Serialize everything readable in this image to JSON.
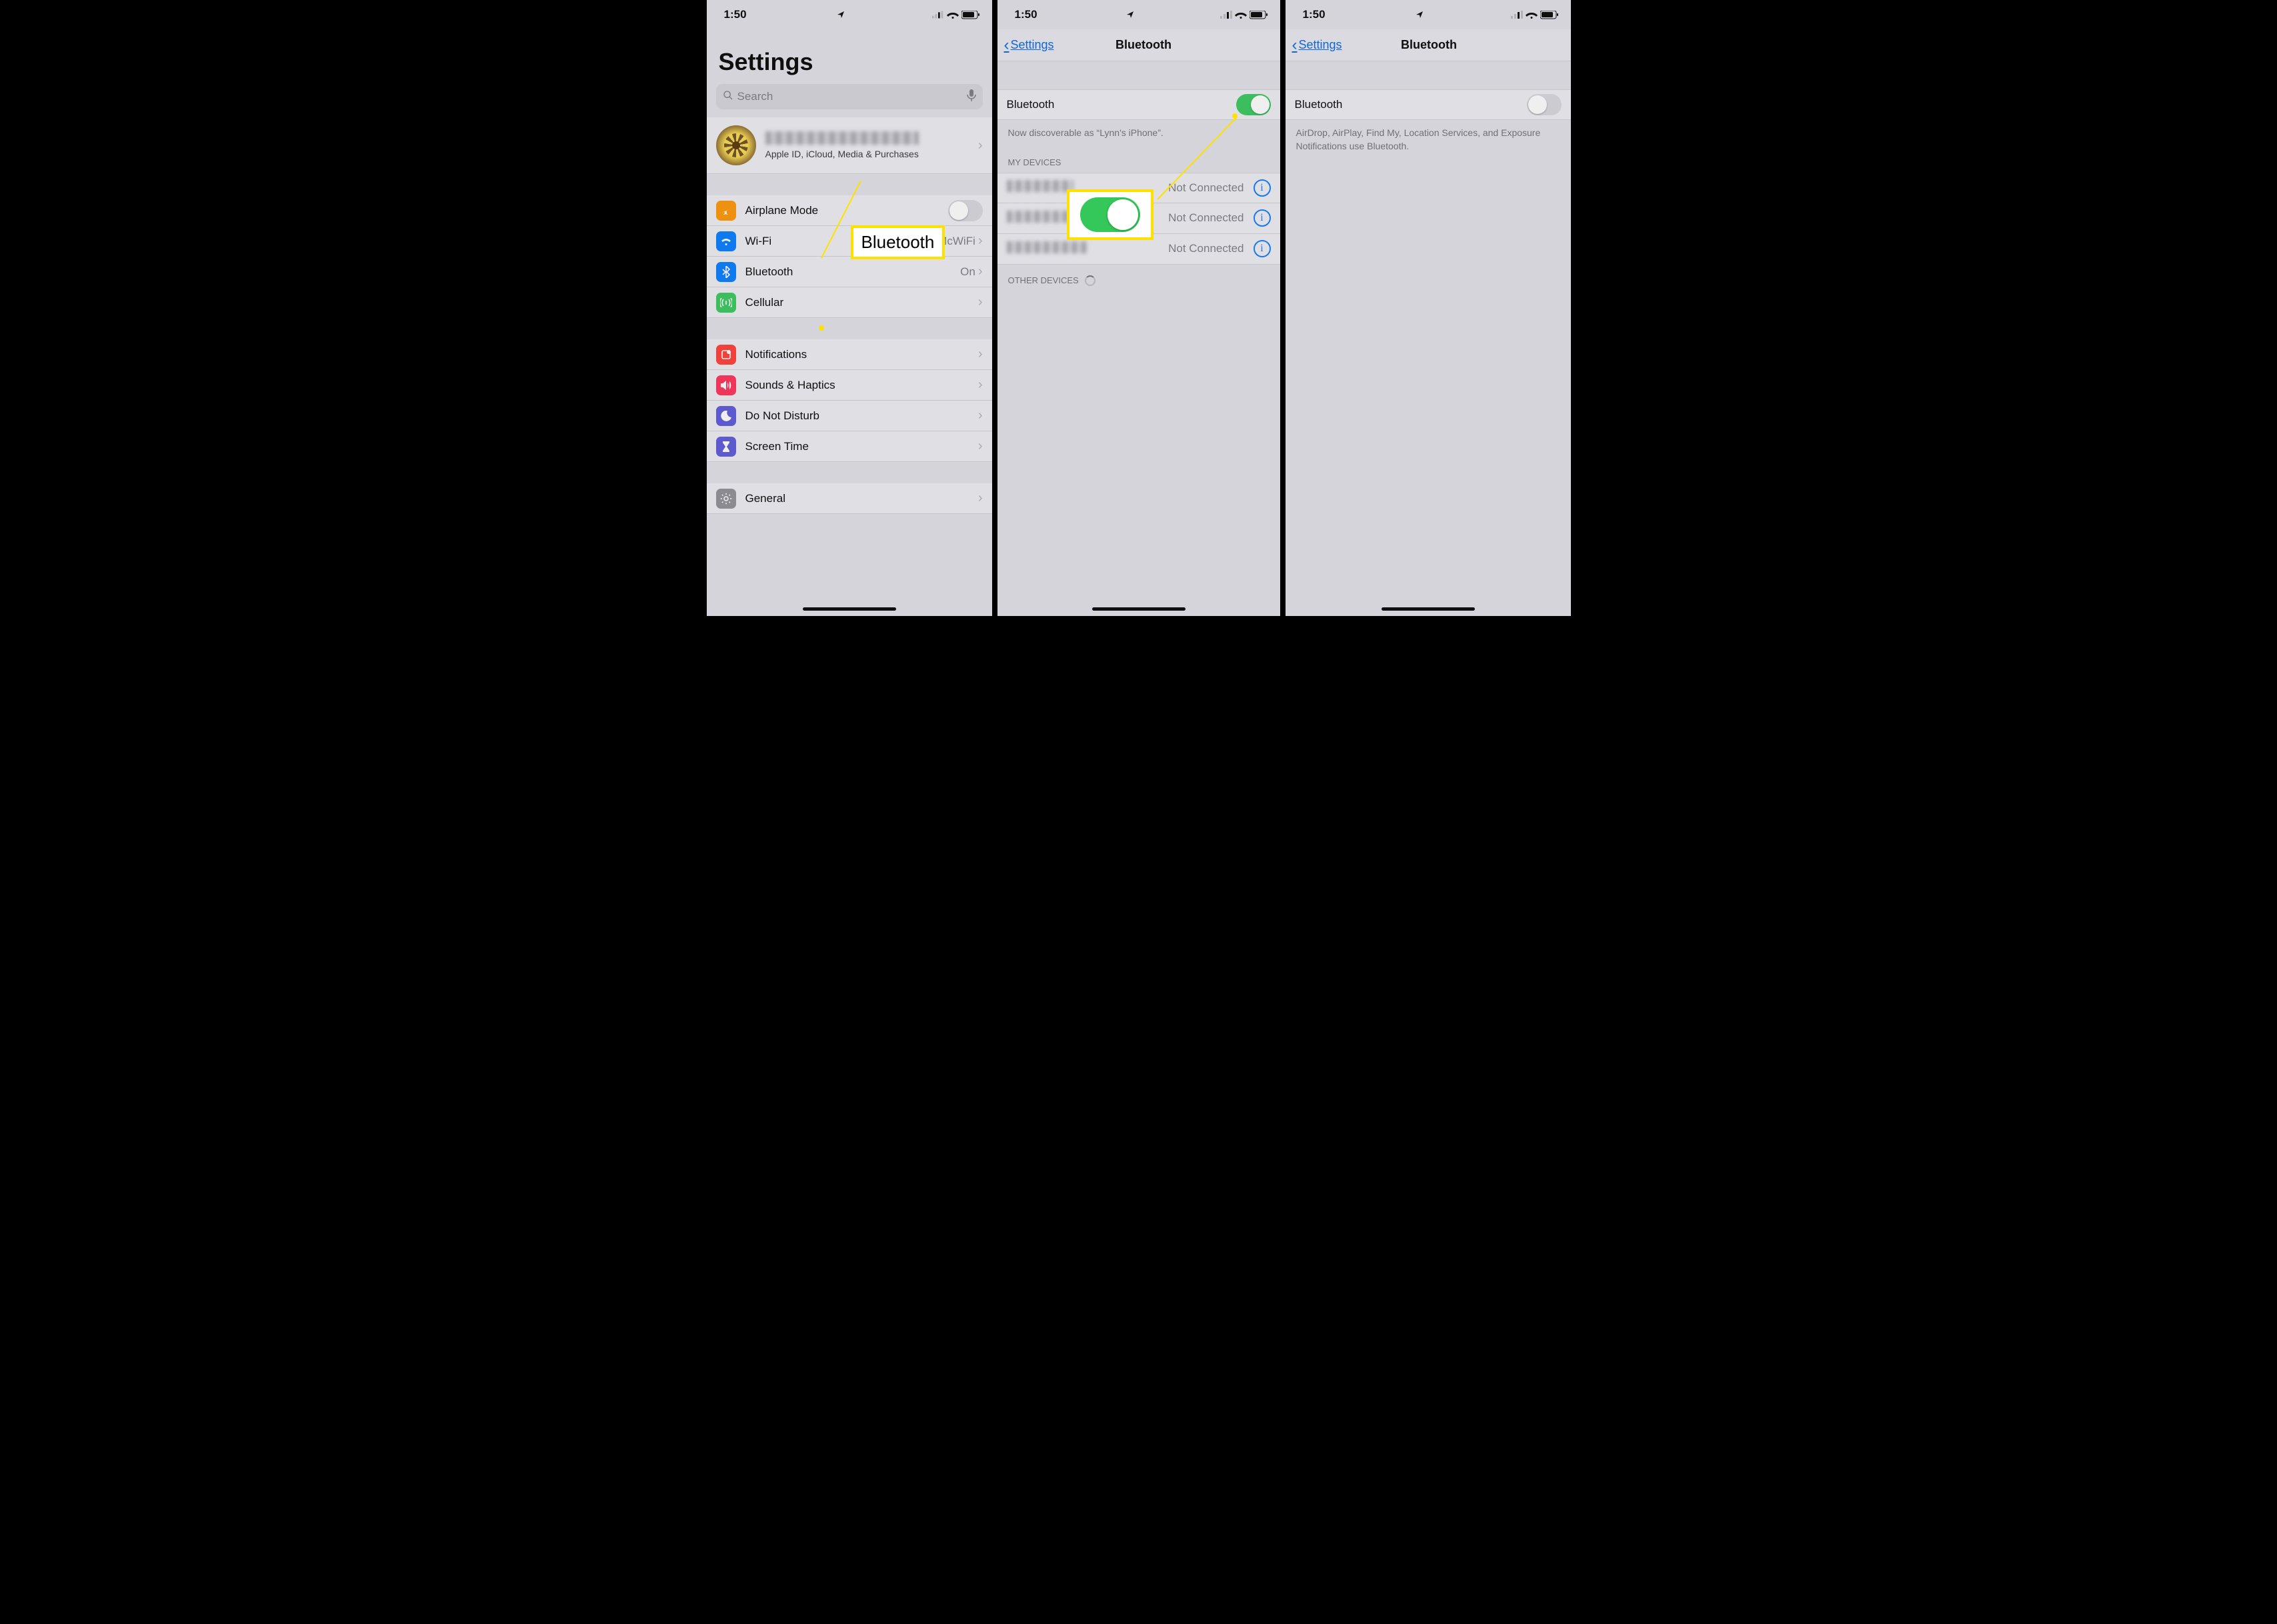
{
  "status": {
    "time": "1:50"
  },
  "panel1": {
    "title": "Settings",
    "search_placeholder": "Search",
    "profile_sub": "Apple ID, iCloud, Media & Purchases",
    "rows_net": [
      {
        "label": "Airplane Mode",
        "value": "",
        "toggle": false
      },
      {
        "label": "Wi-Fi",
        "value": "McWiFi"
      },
      {
        "label": "Bluetooth",
        "value": "On"
      },
      {
        "label": "Cellular",
        "value": ""
      }
    ],
    "rows_mid": [
      {
        "label": "Notifications"
      },
      {
        "label": "Sounds & Haptics"
      },
      {
        "label": "Do Not Disturb"
      },
      {
        "label": "Screen Time"
      }
    ],
    "rows_last": [
      {
        "label": "General"
      }
    ],
    "callout_text": "Bluetooth"
  },
  "panel2": {
    "back": "Settings",
    "title": "Bluetooth",
    "toggle_label": "Bluetooth",
    "discoverable": "Now discoverable as “Lynn's iPhone”.",
    "my_devices": "MY DEVICES",
    "dev_status": "Not Connected",
    "other_devices": "OTHER DEVICES"
  },
  "panel3": {
    "back": "Settings",
    "title": "Bluetooth",
    "toggle_label": "Bluetooth",
    "note": "AirDrop, AirPlay, Find My, Location Services, and Exposure Notifications use Bluetooth."
  }
}
